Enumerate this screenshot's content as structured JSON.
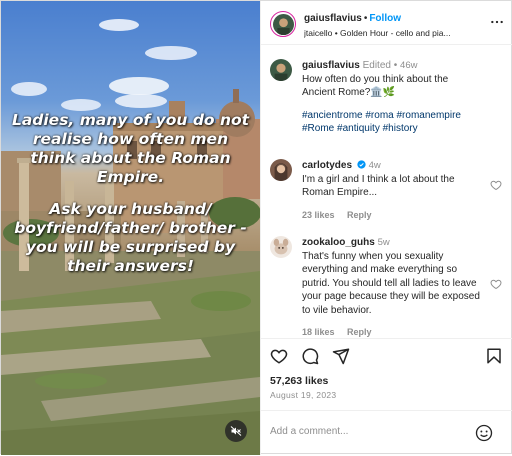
{
  "media": {
    "overlay_lines": [
      "Ladies, many of you do not realise how often men think about the Roman Empire.",
      "Ask your husband/ boyfriend/father/ brother - you will be surprised by their answers!"
    ],
    "mute_icon": "speaker-muted-icon"
  },
  "header": {
    "username": "gaiusflavius",
    "dot": "•",
    "follow_label": "Follow",
    "audio": "jtaicello • Golden Hour - cello and pia...",
    "more_icon": "more-horizontal-icon"
  },
  "caption": {
    "username": "gaiusflavius",
    "edited": "Edited",
    "dot": "•",
    "time": "46w",
    "text": "How often do you think about the Ancient Rome?🏛️🌿",
    "hashtags": "#ancientrome #roma #romanempire #Rome #antiquity #history"
  },
  "comments": [
    {
      "username": "carlotydes",
      "verified": true,
      "time": "4w",
      "text": "I'm a girl and I think a lot about the Roman Empire...",
      "likes": "23 likes",
      "reply": "Reply"
    },
    {
      "username": "zookaloo_guhs",
      "verified": false,
      "time": "5w",
      "text": "That's funny when you sexuality everything and make everything so putrid. You should tell all ladies to leave your page because they will be exposed to vile behavior.",
      "likes": "18 likes",
      "reply": "Reply"
    }
  ],
  "actions": {
    "icons": [
      "heart-icon",
      "comment-icon",
      "share-icon",
      "bookmark-icon"
    ],
    "likes": "57,263 likes",
    "date": "August 19, 2023"
  },
  "add_comment": {
    "placeholder": "Add a comment...",
    "emoji_icon": "emoji-icon"
  },
  "colors": {
    "accent": "#0095f6",
    "hashtag": "#00376b",
    "muted": "#8e8e8e",
    "text": "#262626"
  }
}
